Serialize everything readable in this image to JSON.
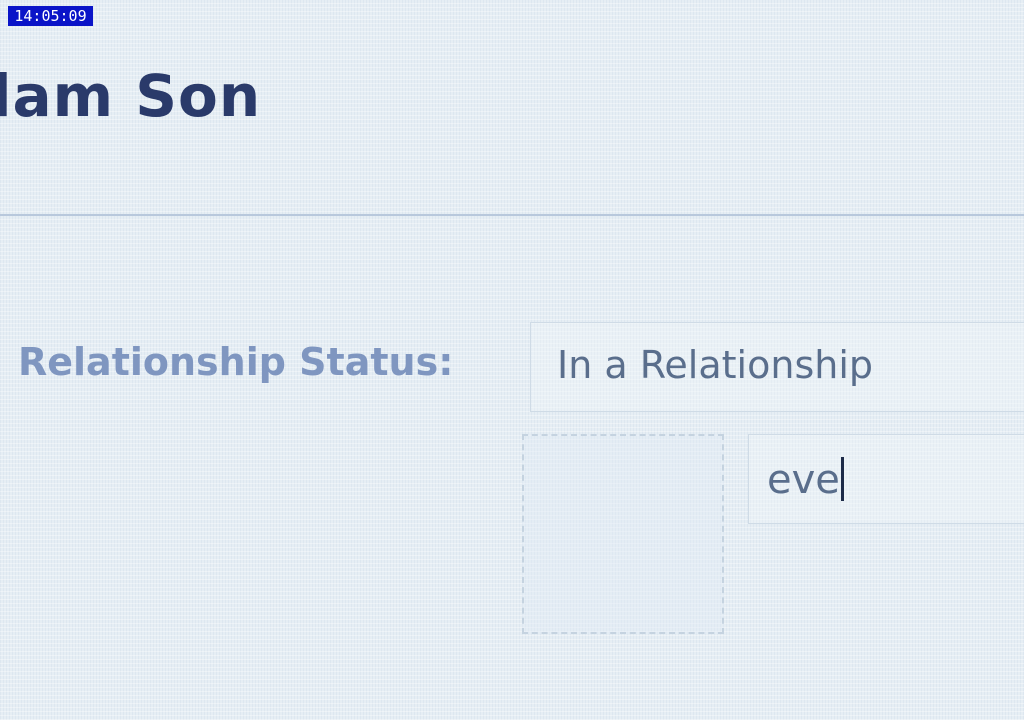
{
  "overlay": {
    "timestamp": "14:05:09"
  },
  "profile": {
    "name": "dam Son"
  },
  "relationship": {
    "label": "Relationship Status:",
    "status_value": "In a Relationship",
    "partner_input_value": "eve"
  },
  "colors": {
    "name_text": "#2a3a6a",
    "label_text": "#7f96c0",
    "value_text": "#5a6e8c",
    "background": "#e6eef4",
    "timestamp_bg": "#0a14c8"
  }
}
